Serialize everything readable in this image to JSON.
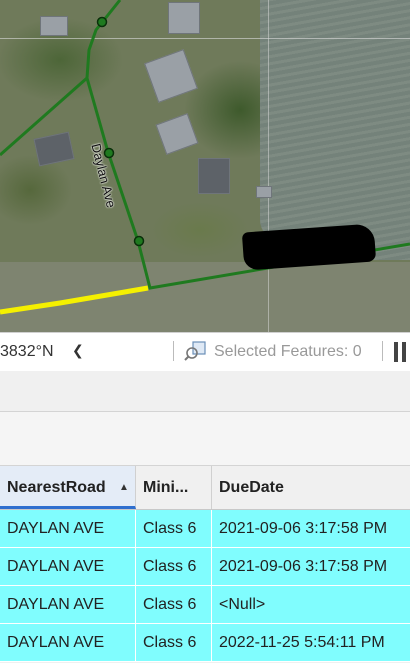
{
  "map": {
    "road_label": "Daylan Ave"
  },
  "statusbar": {
    "coordinate": "3832°N",
    "selected_features_label": "Selected Features: 0"
  },
  "table": {
    "columns": [
      {
        "label": "NearestRoad",
        "sorted": "ascending"
      },
      {
        "label": "Mini..."
      },
      {
        "label": "DueDate"
      }
    ],
    "rows": [
      {
        "road": "DAYLAN AVE",
        "min": "Class 6",
        "due": "2021-09-06 3:17:58 PM"
      },
      {
        "road": "DAYLAN AVE",
        "min": "Class 6",
        "due": "2021-09-06 3:17:58 PM"
      },
      {
        "road": "DAYLAN AVE",
        "min": "Class 6",
        "due": "<Null>"
      },
      {
        "road": "DAYLAN AVE",
        "min": "Class 6",
        "due": "2022-11-25 5:54:11 PM"
      }
    ],
    "row_highlight_color": "#80fdfe",
    "sorted_header_accent": "#2f6fcf"
  }
}
